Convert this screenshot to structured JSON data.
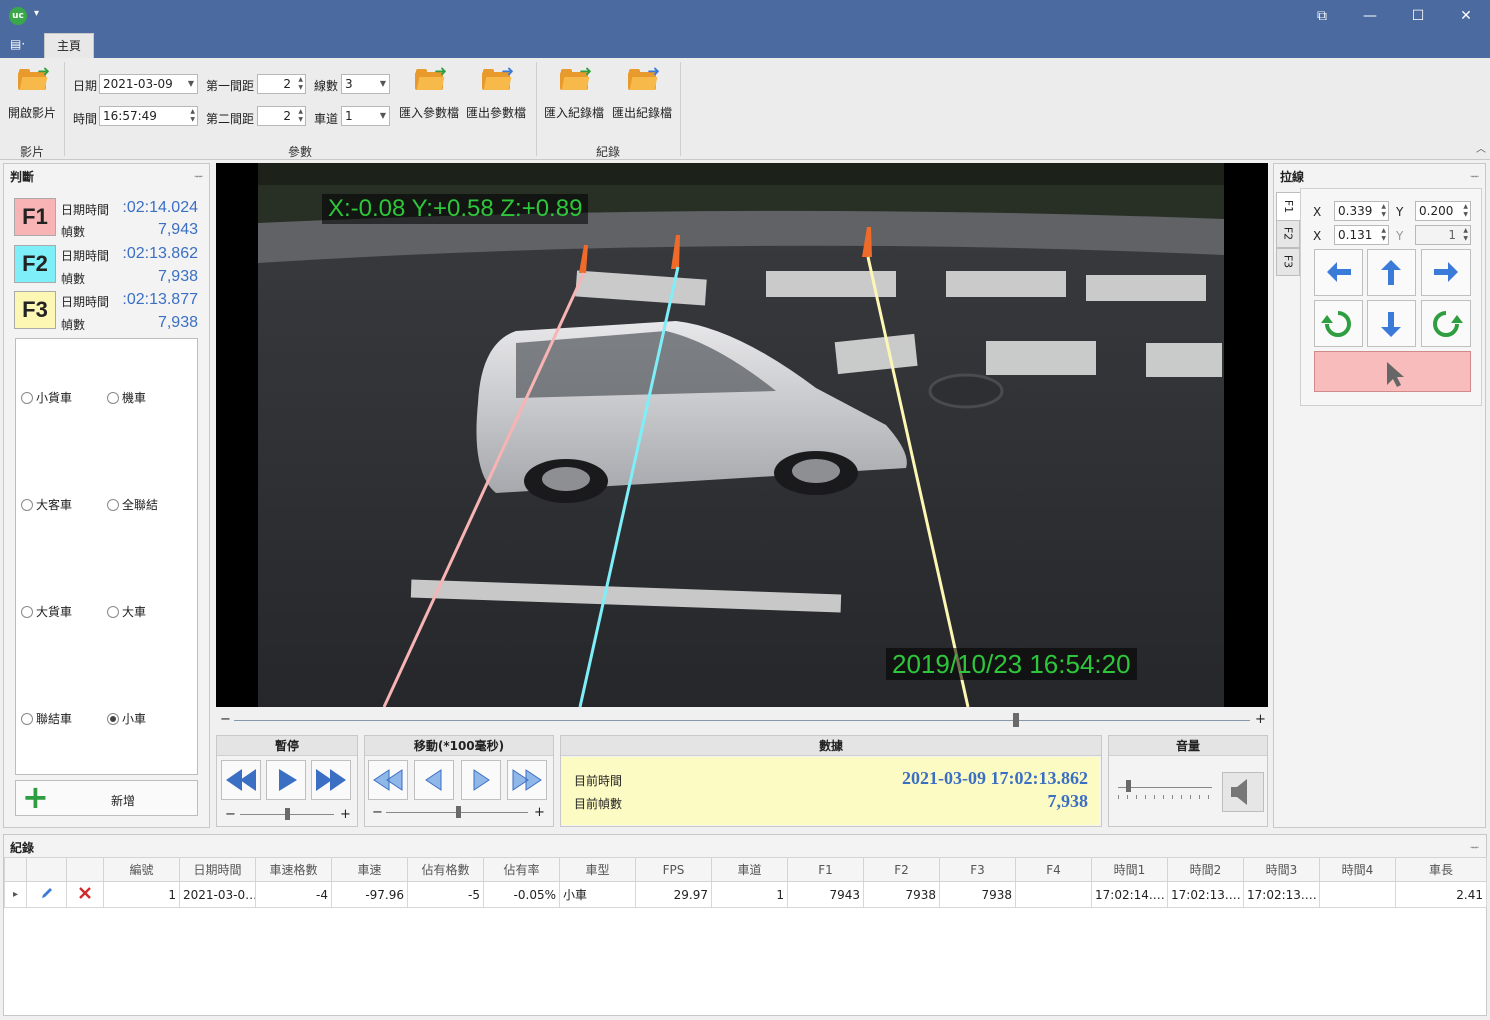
{
  "titlebar": {
    "logo_text": "uc",
    "dropdown": "▾",
    "controls": [
      "⧉",
      "—",
      "☐",
      "✕"
    ]
  },
  "tabs": {
    "file": "▤·",
    "home": "主頁"
  },
  "ribbon": {
    "video_group": {
      "open_label": "開啟影片",
      "group_label": "影片"
    },
    "param_group": {
      "date_label": "日期",
      "date_value": "2021-03-09",
      "time_label": "時間",
      "time_value": "16:57:49",
      "gap1_label": "第一間距",
      "gap1_value": "2",
      "gap2_label": "第二間距",
      "gap2_value": "2",
      "lines_label": "線數",
      "lines_value": "3",
      "lane_label": "車道",
      "lane_value": "1",
      "import_param": "匯入參數檔",
      "export_param": "匯出參數檔",
      "group_label": "參數"
    },
    "record_group": {
      "import_rec": "匯入紀錄檔",
      "export_rec": "匯出紀錄檔",
      "group_label": "紀錄"
    }
  },
  "judge": {
    "title": "判斷",
    "pin": "ᅲ",
    "frames": [
      {
        "tag": "F1",
        "dt_label": "日期時間",
        "dt_value": ":02:14.024",
        "fc_label": "幀數",
        "fc_value": "7,943",
        "color": "#f8b4b4"
      },
      {
        "tag": "F2",
        "dt_label": "日期時間",
        "dt_value": ":02:13.862",
        "fc_label": "幀數",
        "fc_value": "7,938",
        "color": "#7eeef8"
      },
      {
        "tag": "F3",
        "dt_label": "日期時間",
        "dt_value": ":02:13.877",
        "fc_label": "幀數",
        "fc_value": "7,938",
        "color": "#fdf7b4"
      }
    ],
    "vehicles": [
      "小貨車",
      "機車",
      "大客車",
      "全聯結",
      "大貨車",
      "大車",
      "聯結車",
      "小車"
    ],
    "selected": "小車",
    "add_label": "新增"
  },
  "video": {
    "overlay_xyz": "X:-0.08 Y:+0.58 Z:+0.89",
    "timestamp": "2019/10/23 16:54:20",
    "line_colors": [
      "#f8b4b4",
      "#7eeef8",
      "#fdf7b4"
    ],
    "seek_minus": "−",
    "seek_plus": "+"
  },
  "controls": {
    "pause": {
      "title": "暫停"
    },
    "move": {
      "title": "移動(*100毫秒)"
    },
    "data": {
      "title": "數據",
      "time_label": "目前時間",
      "time_value": "2021-03-09 17:02:13.862",
      "frame_label": "目前幀數",
      "frame_value": "7,938"
    },
    "volume": {
      "title": "音量"
    },
    "minus": "−",
    "plus": "+"
  },
  "lines_panel": {
    "title": "拉線",
    "tabs": [
      "F1",
      "F2",
      "F3"
    ],
    "row1": {
      "x_label": "X",
      "x_value": "0.339",
      "y_label": "Y",
      "y_value": "0.200"
    },
    "row2": {
      "x_label": "X",
      "x_value": "0.131",
      "y_label": "Y",
      "y_value": "1"
    }
  },
  "records": {
    "title": "紀錄",
    "columns": [
      "",
      "",
      "",
      "編號",
      "日期時間",
      "車速格數",
      "車速",
      "佔有格數",
      "佔有率",
      "車型",
      "FPS",
      "車道",
      "F1",
      "F2",
      "F3",
      "F4",
      "時間1",
      "時間2",
      "時間3",
      "時間4",
      "車長"
    ],
    "rows": [
      [
        "▸",
        "",
        "",
        "1",
        "2021-03-0…",
        "-4",
        "-97.96",
        "-5",
        "-0.05%",
        "小車",
        "29.97",
        "1",
        "7943",
        "7938",
        "7938",
        "",
        "17:02:14.…",
        "17:02:13.…",
        "17:02:13.…",
        "",
        "2.41"
      ]
    ]
  }
}
